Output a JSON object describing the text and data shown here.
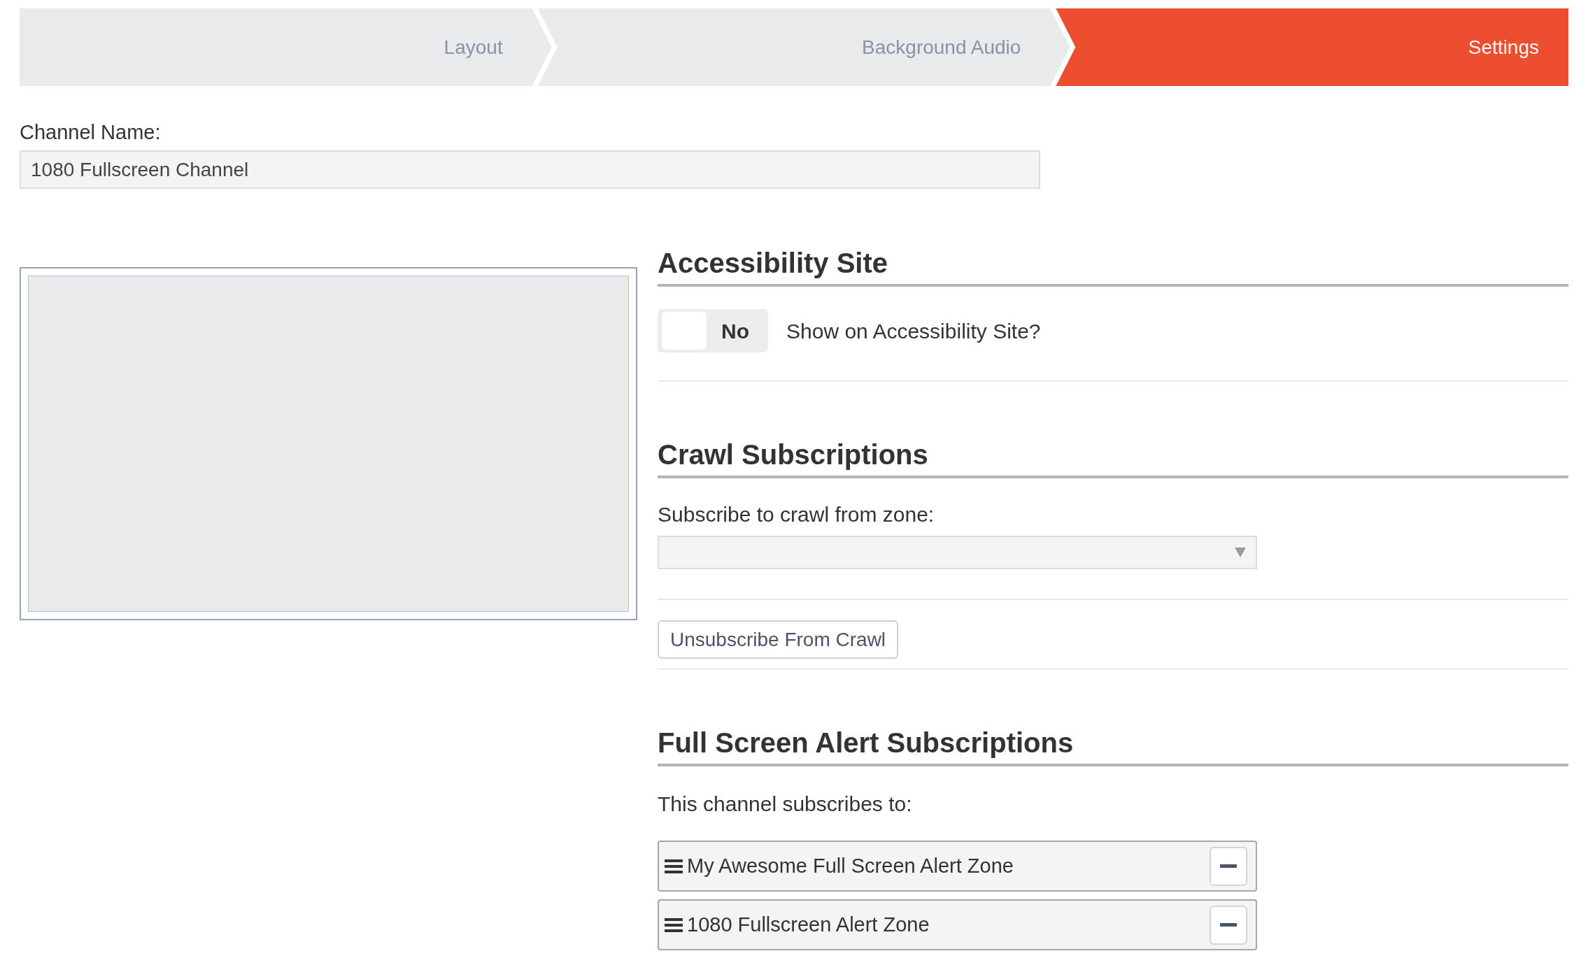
{
  "steps": [
    {
      "label": "Layout",
      "selected": false
    },
    {
      "label": "Background Audio",
      "selected": false
    },
    {
      "label": "Settings",
      "selected": true
    }
  ],
  "channel_name": {
    "label": "Channel Name:",
    "value": "1080 Fullscreen Channel"
  },
  "accessibility": {
    "heading": "Accessibility Site",
    "toggle": {
      "on": false,
      "label": "No"
    },
    "question": "Show on Accessibility Site?"
  },
  "crawl": {
    "heading": "Crawl Subscriptions",
    "select_label": "Subscribe to crawl from zone:",
    "button": "Unsubscribe From Crawl"
  },
  "alerts": {
    "heading": "Full Screen Alert Subscriptions",
    "list_label": "This channel subscribes to:",
    "items": [
      {
        "name": "My Awesome Full Screen Alert Zone"
      },
      {
        "name": "1080 Fullscreen Alert Zone"
      }
    ]
  }
}
